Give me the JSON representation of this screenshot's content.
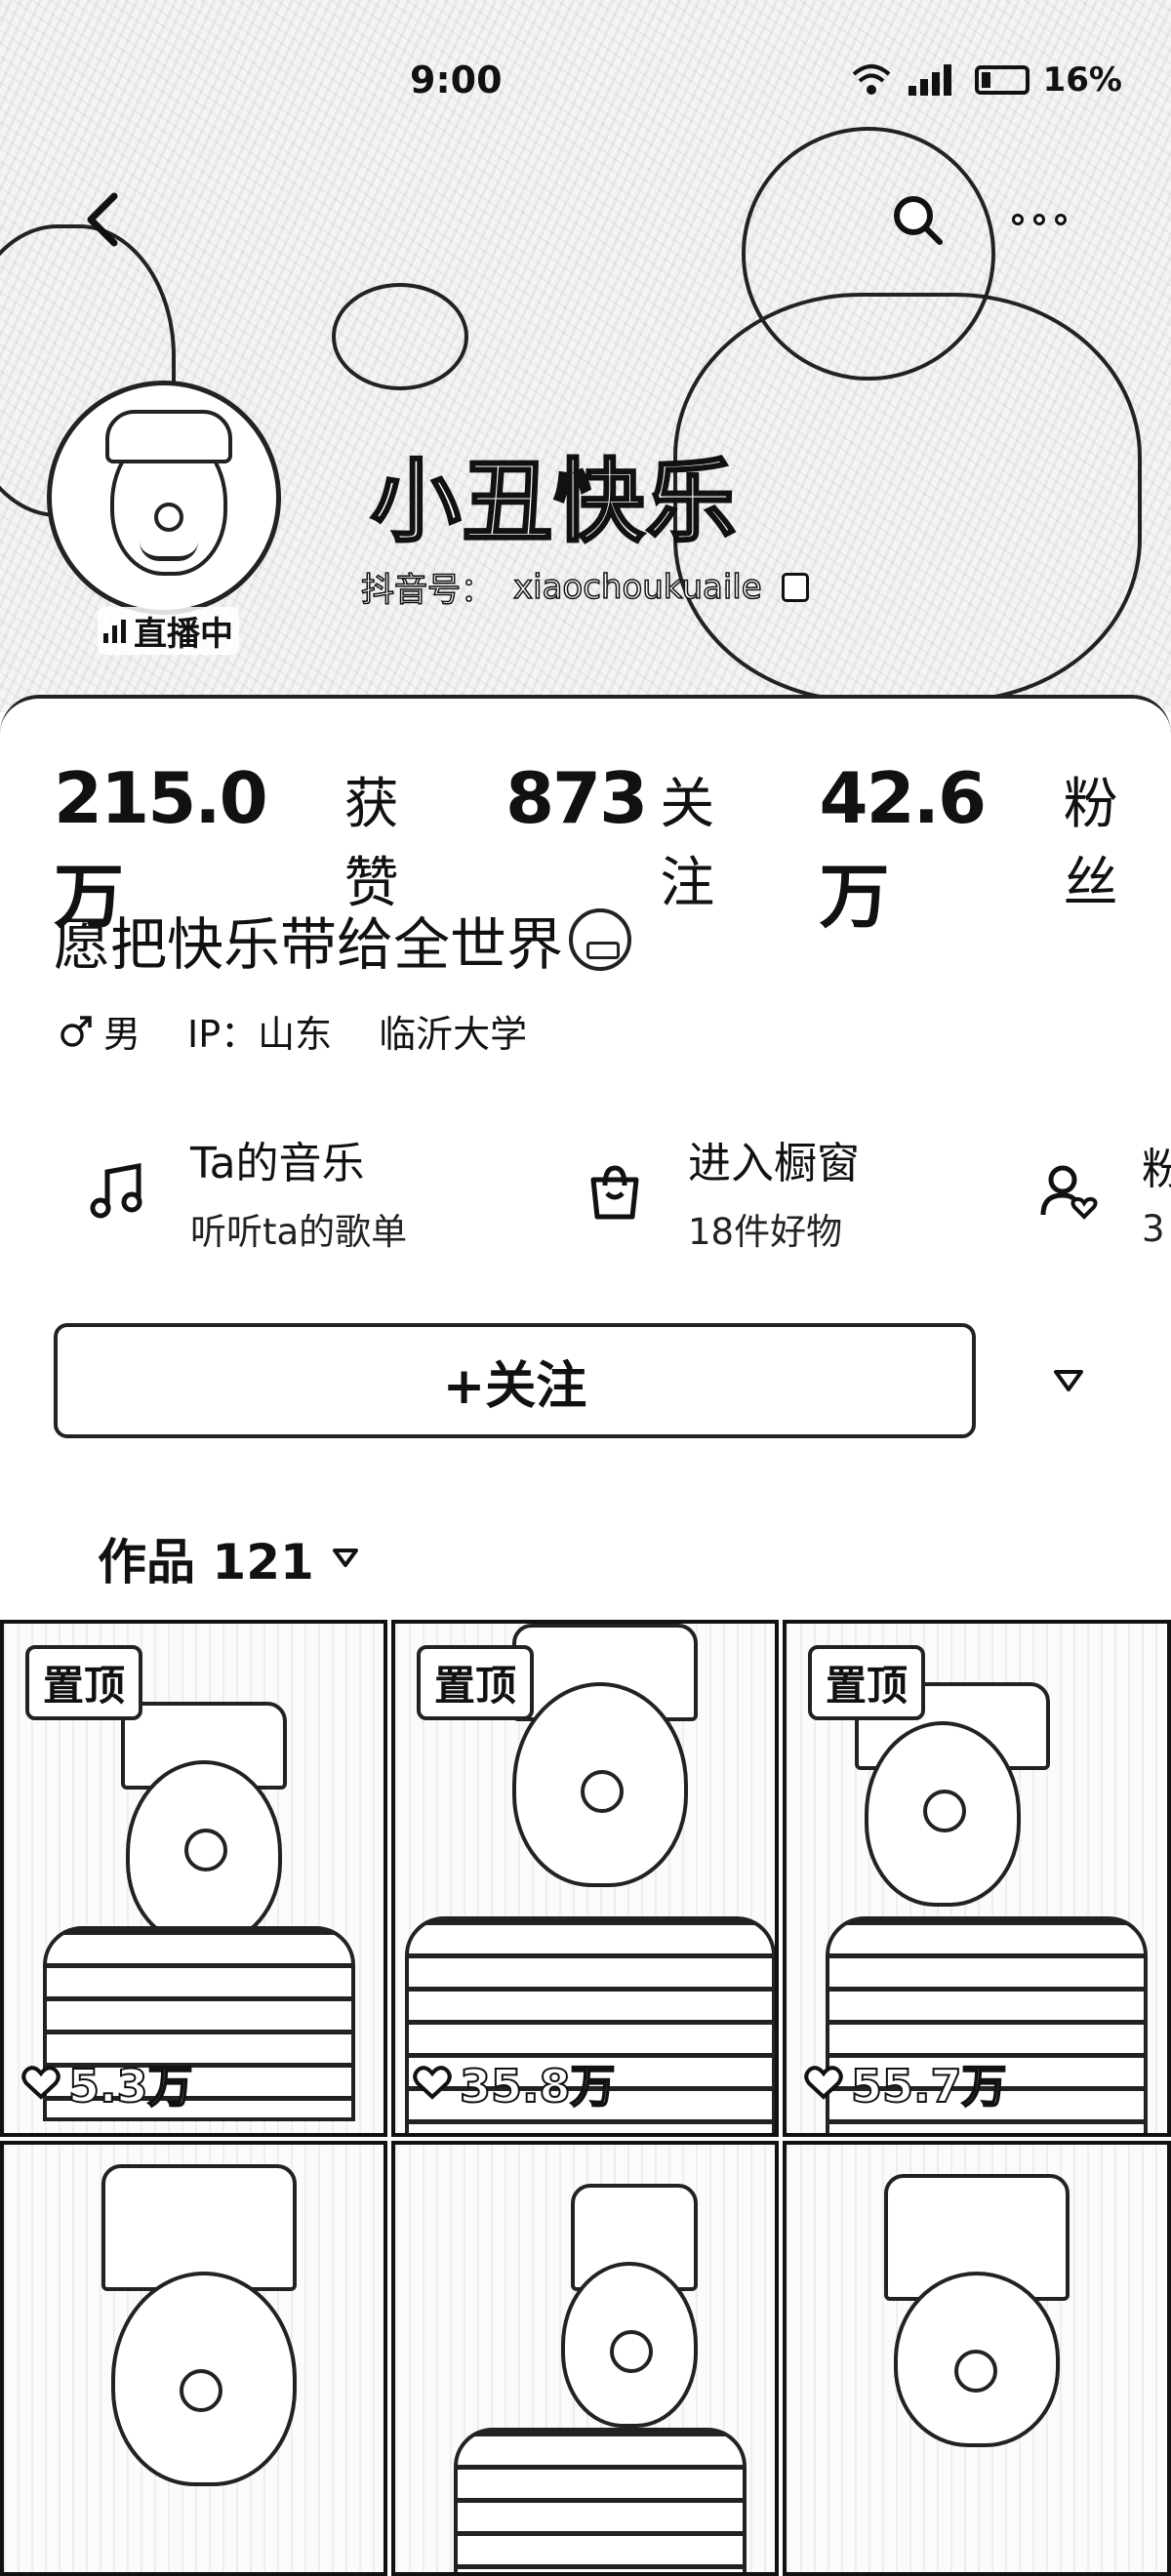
{
  "status_bar": {
    "time": "9:00",
    "battery": "16%"
  },
  "header": {
    "nickname": "小丑快乐",
    "account_label": "抖音号：",
    "account_id": "xiaochoukuaile",
    "live_label": "直播中"
  },
  "stats": [
    {
      "value": "215.0万",
      "label": "获赞"
    },
    {
      "value": "873",
      "label": "关注"
    },
    {
      "value": "42.6万",
      "label": "粉丝"
    }
  ],
  "bio": "愿把快乐带给全世界",
  "tags": {
    "gender": "男",
    "ip": "IP：山东",
    "school": "临沂大学"
  },
  "services": [
    {
      "title": "Ta的音乐",
      "subtitle": "听听ta的歌单",
      "icon": "music-note-icon"
    },
    {
      "title": "进入橱窗",
      "subtitle": "18件好物",
      "icon": "shopping-bag-icon"
    },
    {
      "title": "粉",
      "subtitle": "3",
      "icon": "fan-group-icon"
    }
  ],
  "actions": {
    "follow": "+关注"
  },
  "works_tab": {
    "label": "作品 121"
  },
  "videos": [
    {
      "pinned": "置顶",
      "likes": "5.3万"
    },
    {
      "pinned": "置顶",
      "likes": "35.8万"
    },
    {
      "pinned": "置顶",
      "likes": "55.7万"
    },
    {
      "pinned": "",
      "likes": ""
    },
    {
      "pinned": "",
      "likes": ""
    },
    {
      "pinned": "",
      "likes": ""
    }
  ]
}
